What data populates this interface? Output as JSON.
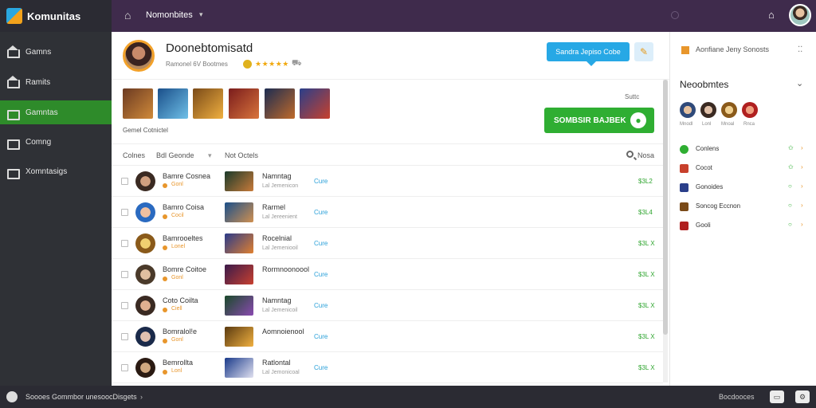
{
  "topbar": {
    "app_name": "Komunitas",
    "title": "Nomonbites"
  },
  "sidebar": {
    "items": [
      {
        "label": "Gamns",
        "icon": "home-icon"
      },
      {
        "label": "Ramits",
        "icon": "home-icon"
      },
      {
        "label": "Gamntas",
        "icon": "grid-icon"
      },
      {
        "label": "Comng",
        "icon": "stack-icon"
      },
      {
        "label": "Xomntasigs",
        "icon": "list-icon"
      }
    ],
    "active_index": 2
  },
  "group": {
    "name": "Doonebtomisatd",
    "sub": "Ramonel 6V Bootmes",
    "stars": "★★★★★"
  },
  "actions": {
    "tip_button": "Sandra Jepiso Cobe",
    "right_note": "Suttc",
    "big_button": "SOMBSIR BAJBEK",
    "members_label": "Gemel Cotnictel"
  },
  "filters": [
    "Colnes",
    "Bdl  Geonde",
    "Not Octels",
    "Nosa"
  ],
  "rows": [
    {
      "name": "Bamre Cosnea",
      "meta": "Gonl",
      "game": "Namntag",
      "sub": "Lal Jemenicon",
      "status": "Cure",
      "price": "$3L2"
    },
    {
      "name": "Bamro Coisa",
      "meta": "Cocil",
      "game": "Rarmel",
      "sub": "Lal Jereenient",
      "status": "Cure",
      "price": "$3L4"
    },
    {
      "name": "Bamrooeltes",
      "meta": "Lonel",
      "game": "Rocelnial",
      "sub": "Lal Jemeniooil",
      "status": "Cure",
      "price": "$3L X"
    },
    {
      "name": "Bomre Coitoe",
      "meta": "Gonl",
      "game": "Rormnoonoool",
      "sub": "",
      "status": "Cure",
      "price": "$3L X"
    },
    {
      "name": "Coto Coilta",
      "meta": "Ciell",
      "game": "Namntag",
      "sub": "Lal Jemenicoil",
      "status": "Cure",
      "price": "$3L X"
    },
    {
      "name": "Bomralol!e",
      "meta": "Gonl",
      "game": "Aomnoienool",
      "sub": "",
      "status": "Cure",
      "price": "$3L X"
    },
    {
      "name": "Bemrollta",
      "meta": "Lonl",
      "game": "Ratlontal",
      "sub": "Lal Jemonicoal",
      "status": "Cure",
      "price": "$3L X"
    }
  ],
  "rpanel": {
    "header": "Aonfiane Jeny Sonosts",
    "title": "Neoobmtes",
    "avatar_labels": [
      "Mnodl",
      "Lonl",
      "Mnoal",
      "Rnca"
    ],
    "items": [
      "Conlens",
      "Cocot",
      "Gonoides",
      "Soncog Eccnon",
      "Gooli"
    ]
  },
  "bottombar": {
    "text": "Soooes  Gommbor unesoocDisgets",
    "right": "Bocdooces"
  }
}
